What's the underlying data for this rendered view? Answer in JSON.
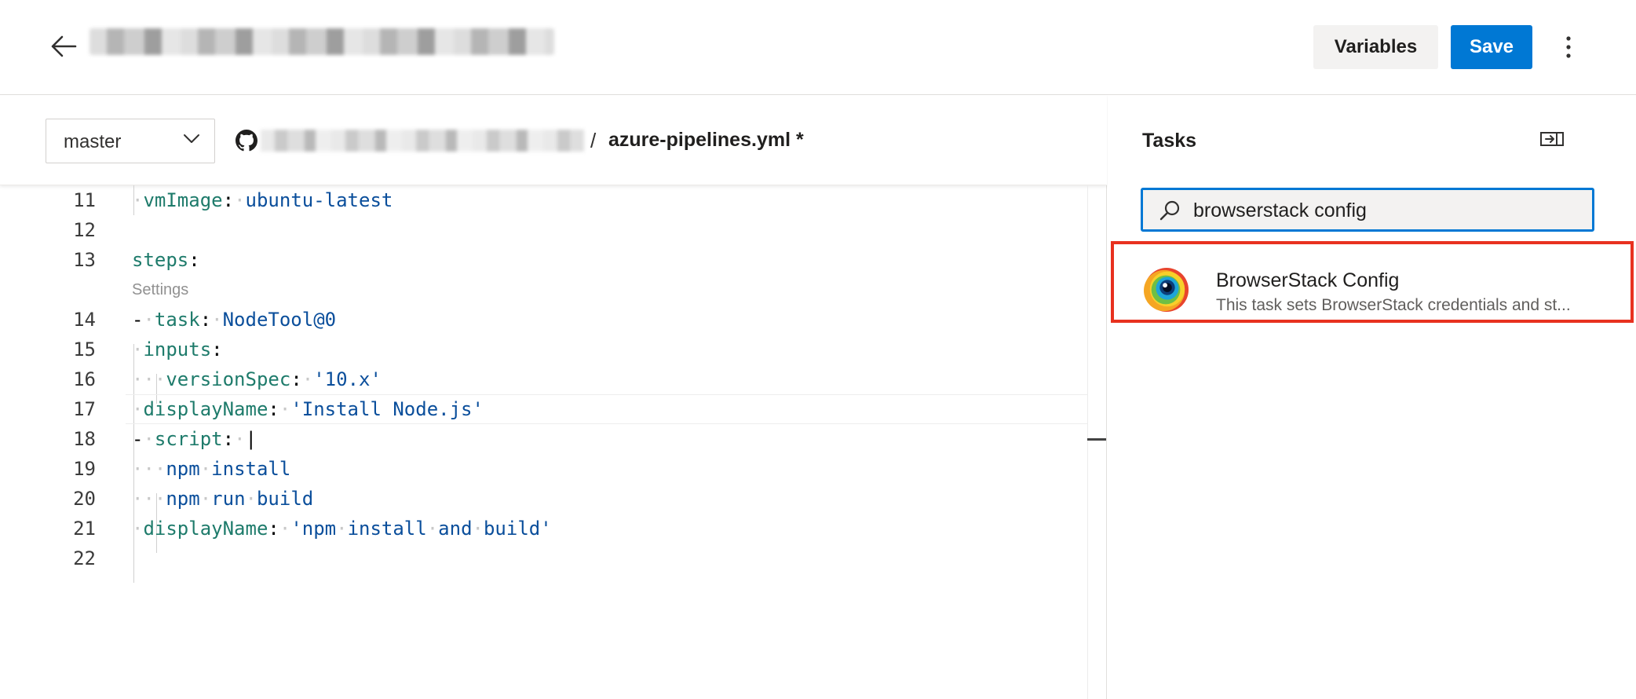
{
  "header": {
    "pipeline_title": "",
    "variables_label": "Variables",
    "save_label": "Save"
  },
  "editor": {
    "branch": "master",
    "path_separator": "/",
    "file_name": "azure-pipelines.yml *",
    "codelens": "Settings",
    "line_numbers": [
      "11",
      "12",
      "13",
      "14",
      "15",
      "16",
      "17",
      "18",
      "19",
      "20",
      "21",
      "22"
    ],
    "code": {
      "l11_key": "vmImage",
      "l11_val": "ubuntu-latest",
      "l13_key": "steps",
      "l14_dash": "-",
      "l14_key": "task",
      "l14_val": "NodeTool@0",
      "l15_key": "inputs",
      "l16_key": "versionSpec",
      "l16_val": "'10.x'",
      "l17_key": "displayName",
      "l17_val": "'Install Node.js'",
      "l18_dash": "-",
      "l18_key": "script",
      "l18_val": "|",
      "l19_w1": "npm",
      "l19_w2": "install",
      "l20_w1": "npm",
      "l20_w2": "run",
      "l20_w3": "build",
      "l21_key": "displayName",
      "l21_val_w1": "'npm",
      "l21_val_w2": "install",
      "l21_val_w3": "and",
      "l21_val_w4": "build'",
      "colon": ":"
    }
  },
  "tasks_panel": {
    "title": "Tasks",
    "search_value": "browserstack config",
    "results": [
      {
        "name": "BrowserStack Config",
        "description": "This task sets BrowserStack credentials and st..."
      }
    ]
  },
  "icons": {
    "back": "arrow-left-icon",
    "more": "vertical-ellipsis-icon",
    "branch_chevron": "chevron-down-icon",
    "repo": "github-icon",
    "collapse_panel": "collapse-panel-icon",
    "search": "search-icon",
    "task_logo": "browserstack-logo-icon"
  },
  "colors": {
    "primary": "#0078d4",
    "highlight_border": "#e8311f",
    "yaml_key": "#1e7b6b",
    "yaml_value": "#0a4e9b"
  }
}
